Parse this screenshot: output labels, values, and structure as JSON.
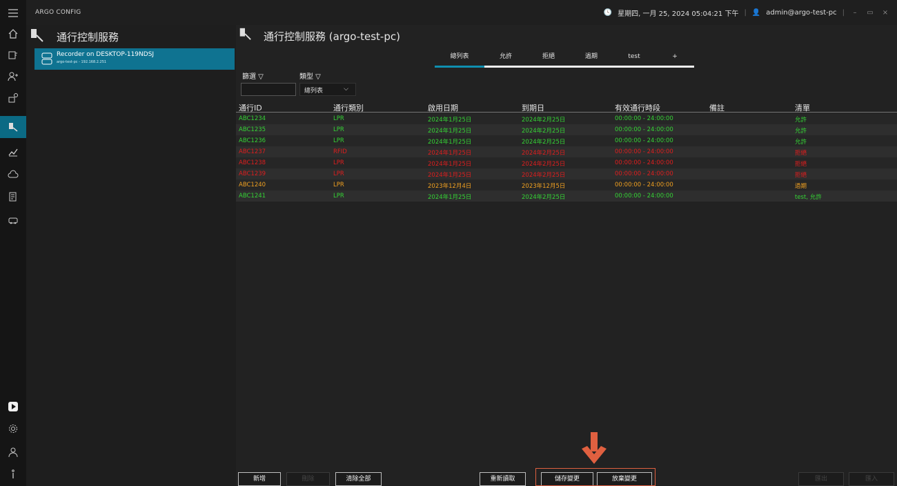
{
  "app": {
    "title": "ARGO CONFIG",
    "datetime": "星期四, 一月 25, 2024 05:04:21 下午",
    "user": "admin@argo-test-pc"
  },
  "rail_icons": [
    "menu-icon",
    "home-icon",
    "device-icon",
    "users-icon",
    "key-icon",
    "access-control-icon",
    "analytics-icon",
    "cloud-icon",
    "report-icon",
    "car-icon",
    "play-icon",
    "settings-icon",
    "account-icon",
    "info-icon"
  ],
  "tree": {
    "title": "通行控制服務",
    "item_name": "Recorder on DESKTOP-119NDSJ",
    "item_sub": "argo-test-pc - 192.168.2.251"
  },
  "main": {
    "title": "通行控制服務 (argo-test-pc)",
    "tabs": [
      "總列表",
      "允許",
      "拒絕",
      "過期",
      "test",
      "+"
    ],
    "filter_label": "篩選 ▽",
    "type_label": "類型 ▽",
    "type_value": "總列表",
    "columns": [
      "通行ID",
      "通行類別",
      "啟用日期",
      "到期日",
      "有效通行時段",
      "備註",
      "清單"
    ],
    "rows": [
      {
        "id": "ABC1234",
        "cat": "LPR",
        "start": "2024年1月25日",
        "end": "2024年2月25日",
        "period": "00:00:00 - 24:00:00",
        "note": "",
        "list": "允許",
        "color": "#35d435"
      },
      {
        "id": "ABC1235",
        "cat": "LPR",
        "start": "2024年1月25日",
        "end": "2024年2月25日",
        "period": "00:00:00 - 24:00:00",
        "note": "",
        "list": "允許",
        "color": "#35d435"
      },
      {
        "id": "ABC1236",
        "cat": "LPR",
        "start": "2024年1月25日",
        "end": "2024年2月25日",
        "period": "00:00:00 - 24:00:00",
        "note": "",
        "list": "允許",
        "color": "#35d435"
      },
      {
        "id": "ABC1237",
        "cat": "RFID",
        "start": "2024年1月25日",
        "end": "2024年2月25日",
        "period": "00:00:00 - 24:00:00",
        "note": "",
        "list": "拒絕",
        "color": "#e01e1e"
      },
      {
        "id": "ABC1238",
        "cat": "LPR",
        "start": "2024年1月25日",
        "end": "2024年2月25日",
        "period": "00:00:00 - 24:00:00",
        "note": "",
        "list": "拒絕",
        "color": "#e01e1e"
      },
      {
        "id": "ABC1239",
        "cat": "LPR",
        "start": "2024年1月25日",
        "end": "2024年2月25日",
        "period": "00:00:00 - 24:00:00",
        "note": "",
        "list": "拒絕",
        "color": "#e01e1e"
      },
      {
        "id": "ABC1240",
        "cat": "LPR",
        "start": "2023年12月4日",
        "end": "2023年12月5日",
        "period": "00:00:00 - 24:00:00",
        "note": "",
        "list": "過期",
        "color": "#f0a020"
      },
      {
        "id": "ABC1241",
        "cat": "LPR",
        "start": "2024年1月25日",
        "end": "2024年2月25日",
        "period": "00:00:00 - 24:00:00",
        "note": "",
        "list": "test, 允許",
        "color": "#35d435"
      }
    ],
    "buttons": {
      "add": "新增",
      "delete": "刪除",
      "clear_all": "清除全部",
      "reload": "重新讀取",
      "save": "儲存變更",
      "discard": "放棄變更",
      "export": "匯出",
      "import": "匯入"
    }
  },
  "colors": {
    "accent": "#0f7391",
    "highlight": "#e06040"
  }
}
